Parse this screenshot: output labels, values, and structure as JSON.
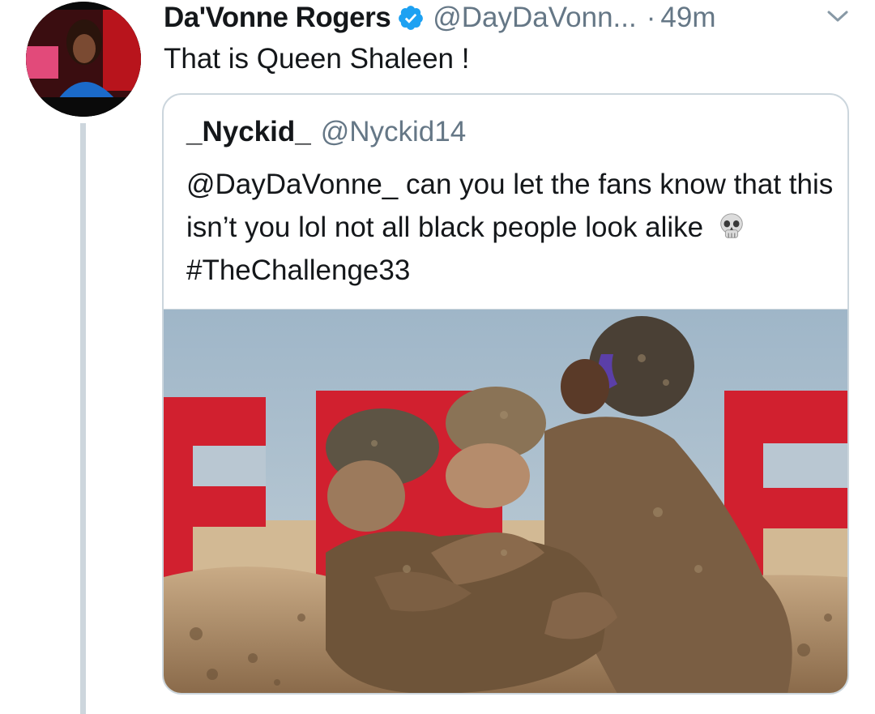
{
  "tweet": {
    "display_name": "Da'Vonne Rogers",
    "handle": "@DayDaVonn...",
    "separator": "·",
    "time": "49m",
    "text": "That is Queen Shaleen !",
    "icons": {
      "verified": "verified-badge-icon",
      "caret": "chevron-down-icon"
    },
    "colors": {
      "verified": "#1da1f2",
      "secondary_text": "#657786",
      "thread_line": "#cdd6dd"
    }
  },
  "quoted": {
    "display_name": "_Nyckid_",
    "handle": "@Nyckid14",
    "text_part1": "@DayDaVonne_ can you let the fans know that this isn’t you lol not all black people look alike",
    "emoji": "skull-emoji",
    "text_part2": "#TheChallenge33",
    "media": {
      "type": "photo",
      "sign_letters": [
        "F",
        "N",
        "F"
      ],
      "colors": {
        "sky": "#a9bfd0",
        "sign": "#d42336",
        "mud": "#7d6448",
        "sand": "#c2a07a"
      }
    }
  }
}
